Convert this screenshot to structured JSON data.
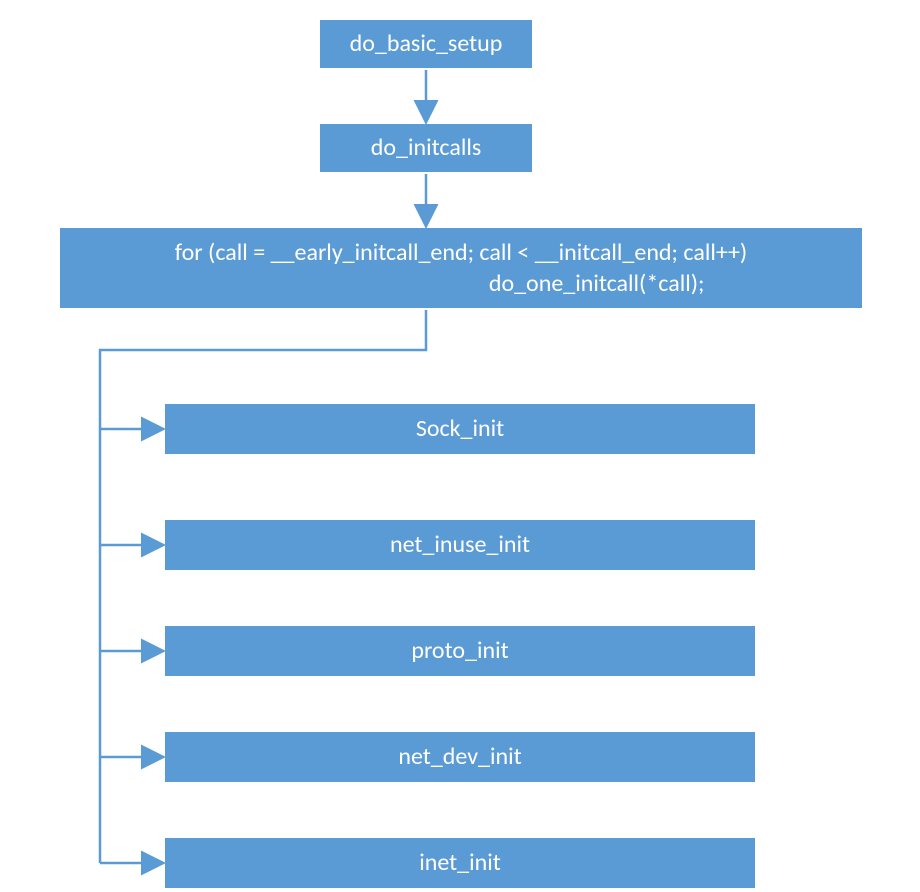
{
  "colors": {
    "box_fill": "#5b9bd5",
    "box_border": "#ffffff",
    "arrow": "#5b9bd5",
    "text": "#ffffff"
  },
  "boxes": {
    "do_basic_setup": "do_basic_setup",
    "do_initcalls": "do_initcalls",
    "for_loop": "for (call = __early_initcall_end; call < __initcall_end; call++)\n                                                  do_one_initcall(*call);",
    "sock_init": "Sock_init",
    "net_inuse_init": "net_inuse_init",
    "proto_init": "proto_init",
    "net_dev_init": "net_dev_init",
    "inet_init": "inet_init"
  }
}
